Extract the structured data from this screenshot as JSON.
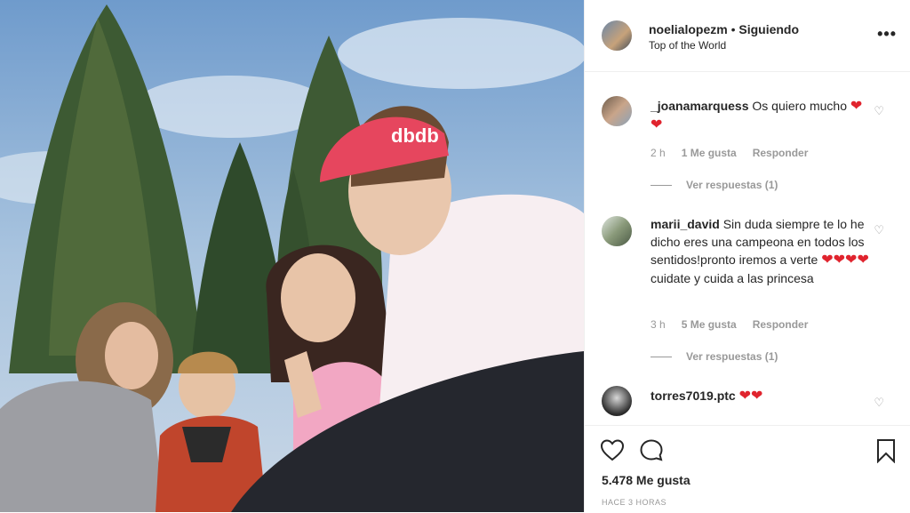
{
  "post": {
    "username": "noelialopezm",
    "separator": " • ",
    "follow_status": "Siguiendo",
    "location": "Top of the World",
    "more_icon": "more-options-icon",
    "cap_text": "dbdb"
  },
  "comments": [
    {
      "username": "_joanamarquess",
      "text": "Os quiero mucho",
      "hearts": "❤❤",
      "time": "2 h",
      "likes": "1 Me gusta",
      "reply": "Responder",
      "view_replies": "Ver respuestas (1)"
    },
    {
      "username": "marii_david",
      "text_part1": "Sin duda siempre te lo he dicho eres una campeona en todos los sentidos!pronto iremos a verte",
      "hearts": "❤❤❤❤",
      "text_part2": "cuidate y cuida a las princesa",
      "time": "3 h",
      "likes": "5 Me gusta",
      "reply": "Responder",
      "view_replies": "Ver respuestas (1)"
    },
    {
      "username": "torres7019.ptc",
      "hearts": "❤❤"
    }
  ],
  "footer": {
    "likes_count": "5.478 Me gusta",
    "timestamp": "HACE 3 HORAS"
  },
  "colors": {
    "heart": "#e0242e",
    "meta_gray": "#999999",
    "border": "#efefef"
  }
}
